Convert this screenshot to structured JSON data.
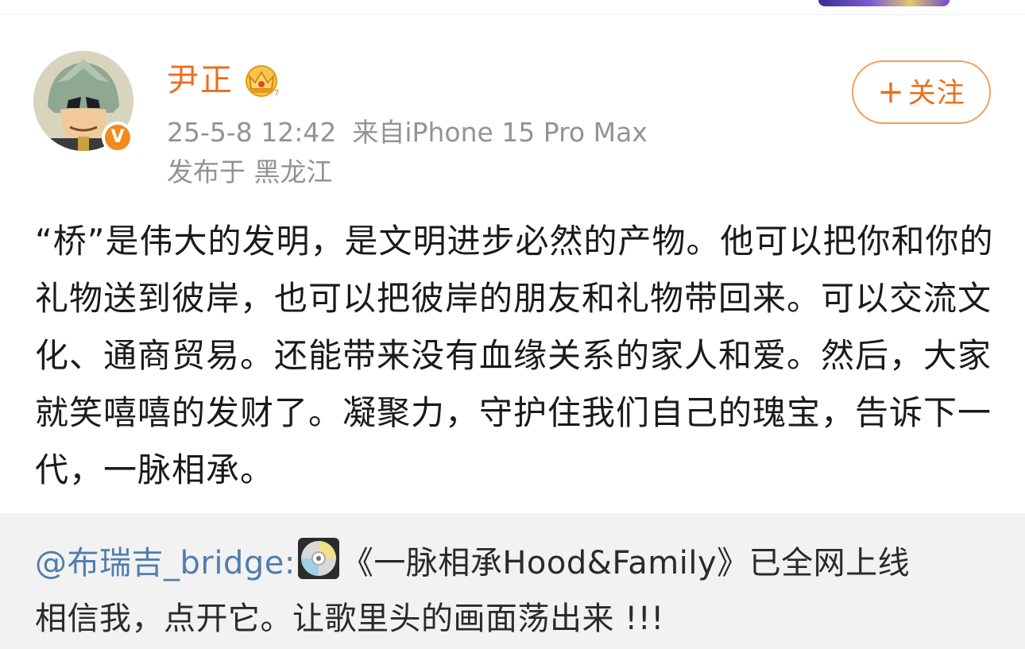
{
  "user": {
    "name": "尹正",
    "verified": "V",
    "timestamp": "25-5-8 12:42",
    "source": "来自iPhone 15 Pro Max",
    "location": "发布于 黑龙江"
  },
  "follow": {
    "plus": "+",
    "label": "关注"
  },
  "post": {
    "text": "“桥”是伟大的发明，是文明进步必然的产物。他可以把你和你的礼物送到彼岸，也可以把彼岸的朋友和礼物带回来。可以交流文化、通商贸易。还能带来没有血缘关系的家人和爱。然后，大家就笑嘻嘻的发财了。凝聚力，守护住我们自己的瑰宝，告诉下一代，一脉相承。"
  },
  "repost": {
    "mention": "@布瑞吉_bridge:",
    "text_before_break": "《一脉相承Hood&Family》已全网上线",
    "text_after_break": "相信我，点开它。让歌里头的画面荡出来 !!!"
  },
  "colors": {
    "accent": "#e8701f",
    "link": "#507daf",
    "meta": "#939393"
  },
  "icons": [
    "crown-icon",
    "cd-icon",
    "verified-icon"
  ]
}
